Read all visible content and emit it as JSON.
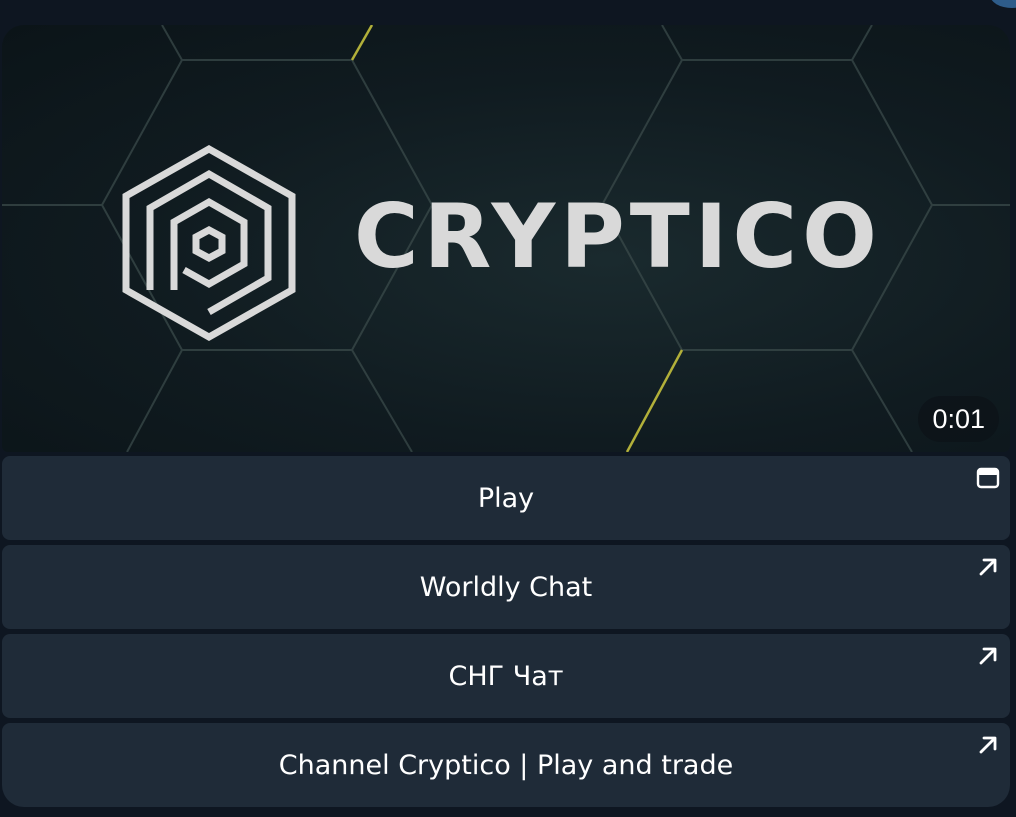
{
  "media": {
    "brand_name": "CRYPTICO",
    "duration": "0:01",
    "logo_icon": "cryptico-logo-icon"
  },
  "keyboard": {
    "buttons": [
      {
        "label": "Play",
        "icon": "web-app-window-icon"
      },
      {
        "label": "Worldly Chat",
        "icon": "external-link-arrow-icon"
      },
      {
        "label": "СНГ Чат",
        "icon": "external-link-arrow-icon"
      },
      {
        "label": "Channel Cryptico | Play and trade",
        "icon": "external-link-arrow-icon"
      }
    ]
  },
  "colors": {
    "background": "#0e1621",
    "button_bg": "#1f2b38",
    "text": "#ffffff",
    "brand_text": "#d9d9d9",
    "accent_line": "#c9c43a"
  }
}
